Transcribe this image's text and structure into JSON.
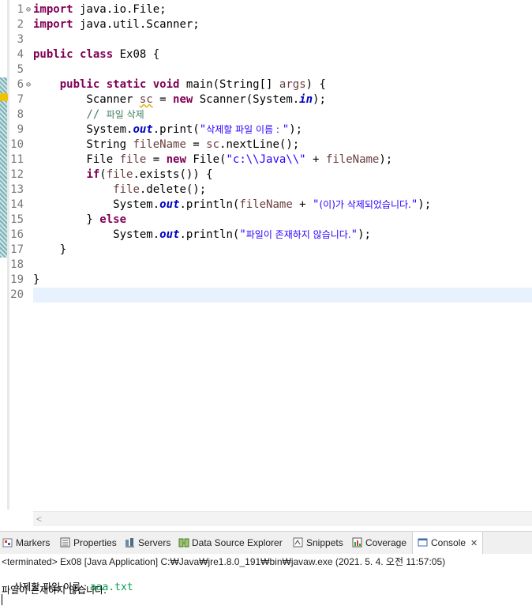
{
  "editor": {
    "lines": [
      {
        "n": "1",
        "fold": true,
        "segs": [
          {
            "t": "import",
            "c": "kw"
          },
          {
            "t": " java.io.File;"
          }
        ]
      },
      {
        "n": "2",
        "segs": [
          {
            "t": "import",
            "c": "kw"
          },
          {
            "t": " java.util.Scanner;"
          }
        ]
      },
      {
        "n": "3",
        "segs": []
      },
      {
        "n": "4",
        "segs": [
          {
            "t": "public",
            "c": "kw"
          },
          {
            "t": " "
          },
          {
            "t": "class",
            "c": "kw"
          },
          {
            "t": " Ex08 {"
          }
        ]
      },
      {
        "n": "5",
        "segs": []
      },
      {
        "n": "6",
        "fold": true,
        "segs": [
          {
            "t": "    "
          },
          {
            "t": "public",
            "c": "kw"
          },
          {
            "t": " "
          },
          {
            "t": "static",
            "c": "kw"
          },
          {
            "t": " "
          },
          {
            "t": "void",
            "c": "kw"
          },
          {
            "t": " main(String[] "
          },
          {
            "t": "args",
            "c": "var"
          },
          {
            "t": ") {"
          }
        ]
      },
      {
        "n": "7",
        "segs": [
          {
            "t": "        Scanner "
          },
          {
            "t": "sc",
            "c": "var warn"
          },
          {
            "t": " = "
          },
          {
            "t": "new",
            "c": "kw"
          },
          {
            "t": " Scanner(System."
          },
          {
            "t": "in",
            "c": "fld"
          },
          {
            "t": ");"
          }
        ]
      },
      {
        "n": "8",
        "segs": [
          {
            "t": "        "
          },
          {
            "t": "// ",
            "c": "com"
          },
          {
            "t": "파일 삭제",
            "c": "com ko"
          }
        ]
      },
      {
        "n": "9",
        "segs": [
          {
            "t": "        System."
          },
          {
            "t": "out",
            "c": "fld"
          },
          {
            "t": ".print("
          },
          {
            "t": "\"",
            "c": "str"
          },
          {
            "t": "삭제할 파일 이름 : ",
            "c": "str ko"
          },
          {
            "t": "\"",
            "c": "str"
          },
          {
            "t": ");"
          }
        ]
      },
      {
        "n": "10",
        "segs": [
          {
            "t": "        String "
          },
          {
            "t": "fileName",
            "c": "var"
          },
          {
            "t": " = "
          },
          {
            "t": "sc",
            "c": "var"
          },
          {
            "t": ".nextLine();"
          }
        ]
      },
      {
        "n": "11",
        "segs": [
          {
            "t": "        File "
          },
          {
            "t": "file",
            "c": "var"
          },
          {
            "t": " = "
          },
          {
            "t": "new",
            "c": "kw"
          },
          {
            "t": " File("
          },
          {
            "t": "\"c:\\\\Java\\\\\"",
            "c": "str"
          },
          {
            "t": " + "
          },
          {
            "t": "fileName",
            "c": "var"
          },
          {
            "t": ");"
          }
        ]
      },
      {
        "n": "12",
        "segs": [
          {
            "t": "        "
          },
          {
            "t": "if",
            "c": "kw"
          },
          {
            "t": "("
          },
          {
            "t": "file",
            "c": "var"
          },
          {
            "t": ".exists()) {"
          }
        ]
      },
      {
        "n": "13",
        "segs": [
          {
            "t": "            "
          },
          {
            "t": "file",
            "c": "var"
          },
          {
            "t": ".delete();"
          }
        ]
      },
      {
        "n": "14",
        "segs": [
          {
            "t": "            System."
          },
          {
            "t": "out",
            "c": "fld"
          },
          {
            "t": ".println("
          },
          {
            "t": "fileName",
            "c": "var"
          },
          {
            "t": " + "
          },
          {
            "t": "\"",
            "c": "str"
          },
          {
            "t": "(이)가 삭제되었습니다.",
            "c": "str ko"
          },
          {
            "t": "\"",
            "c": "str"
          },
          {
            "t": ");"
          }
        ]
      },
      {
        "n": "15",
        "segs": [
          {
            "t": "        } "
          },
          {
            "t": "else",
            "c": "kw"
          }
        ]
      },
      {
        "n": "16",
        "segs": [
          {
            "t": "            System."
          },
          {
            "t": "out",
            "c": "fld"
          },
          {
            "t": ".println("
          },
          {
            "t": "\"",
            "c": "str"
          },
          {
            "t": "파일이 존재하지 않습니다.",
            "c": "str ko"
          },
          {
            "t": "\"",
            "c": "str"
          },
          {
            "t": ");"
          }
        ]
      },
      {
        "n": "17",
        "segs": [
          {
            "t": "    }"
          }
        ]
      },
      {
        "n": "18",
        "segs": []
      },
      {
        "n": "19",
        "segs": [
          {
            "t": "}"
          }
        ]
      },
      {
        "n": "20",
        "segs": []
      }
    ],
    "hscroll_left": "<"
  },
  "tabs": [
    {
      "id": "markers",
      "label": "Markers",
      "icon": "markers-icon"
    },
    {
      "id": "properties",
      "label": "Properties",
      "icon": "properties-icon"
    },
    {
      "id": "servers",
      "label": "Servers",
      "icon": "servers-icon"
    },
    {
      "id": "dse",
      "label": "Data Source Explorer",
      "icon": "data-source-explorer-icon"
    },
    {
      "id": "snippets",
      "label": "Snippets",
      "icon": "snippets-icon"
    },
    {
      "id": "coverage",
      "label": "Coverage",
      "icon": "coverage-icon"
    },
    {
      "id": "console",
      "label": "Console",
      "icon": "console-icon",
      "active": true,
      "close": "✕"
    }
  ],
  "console": {
    "description": "<terminated> Ex08 [Java Application] C:₩Java₩jre1.8.0_191₩bin₩javaw.exe (2021. 5. 4. 오전 11:57:05)",
    "prompt": "삭제할 파일 이름 : ",
    "input": "aaa.txt",
    "output": "파일이 존재하지 않습니다."
  },
  "colors": {
    "keyword": "#7f0055",
    "string": "#2a00ff",
    "comment": "#3f7f5f",
    "field": "#0000c0",
    "local_var": "#6a3e3e",
    "console_input": "#00a050",
    "current_line": "#e8f2fe"
  }
}
